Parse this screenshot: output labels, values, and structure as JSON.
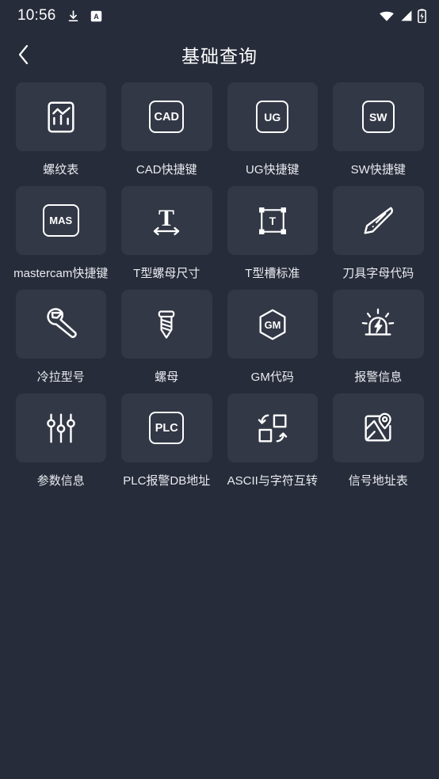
{
  "statusbar": {
    "time": "10:56",
    "left_icons": [
      "download-icon",
      "a-badge-icon"
    ],
    "right_icons": [
      "wifi-icon",
      "cellular-signal-icon",
      "battery-charging-icon"
    ]
  },
  "header": {
    "back_icon": "chevron-left-icon",
    "title": "基础查询"
  },
  "colors": {
    "page_background": "#272c3a",
    "tile_background": "#333846",
    "text": "#e9ebef",
    "icon": "#ffffff"
  },
  "grid": {
    "items": [
      {
        "label": "螺纹表",
        "icon": "thread-chart-icon"
      },
      {
        "label": "CAD快捷键",
        "icon": "cad-badge-icon",
        "badge": "CAD"
      },
      {
        "label": "UG快捷键",
        "icon": "ug-badge-icon",
        "badge": "UG"
      },
      {
        "label": "SW快捷键",
        "icon": "sw-badge-icon",
        "badge": "SW"
      },
      {
        "label": "mastercam快捷键",
        "icon": "mastercam-badge-icon",
        "badge": "MAS"
      },
      {
        "label": "T型螺母尺寸",
        "icon": "t-nut-dimension-icon"
      },
      {
        "label": "T型槽标准",
        "icon": "t-slot-standard-icon"
      },
      {
        "label": "刀具字母代码",
        "icon": "cutter-blade-icon"
      },
      {
        "label": "冷拉型号",
        "icon": "wrench-icon"
      },
      {
        "label": "螺母",
        "icon": "screw-icon"
      },
      {
        "label": "GM代码",
        "icon": "gm-hexagon-icon",
        "badge": "GM"
      },
      {
        "label": "报警信息",
        "icon": "alarm-siren-icon"
      },
      {
        "label": "参数信息",
        "icon": "sliders-icon"
      },
      {
        "label": "PLC报警DB地址",
        "icon": "plc-badge-icon",
        "badge": "PLC"
      },
      {
        "label": "ASCII与字符互转",
        "icon": "ascii-swap-icon"
      },
      {
        "label": "信号地址表",
        "icon": "map-pin-icon"
      }
    ]
  }
}
